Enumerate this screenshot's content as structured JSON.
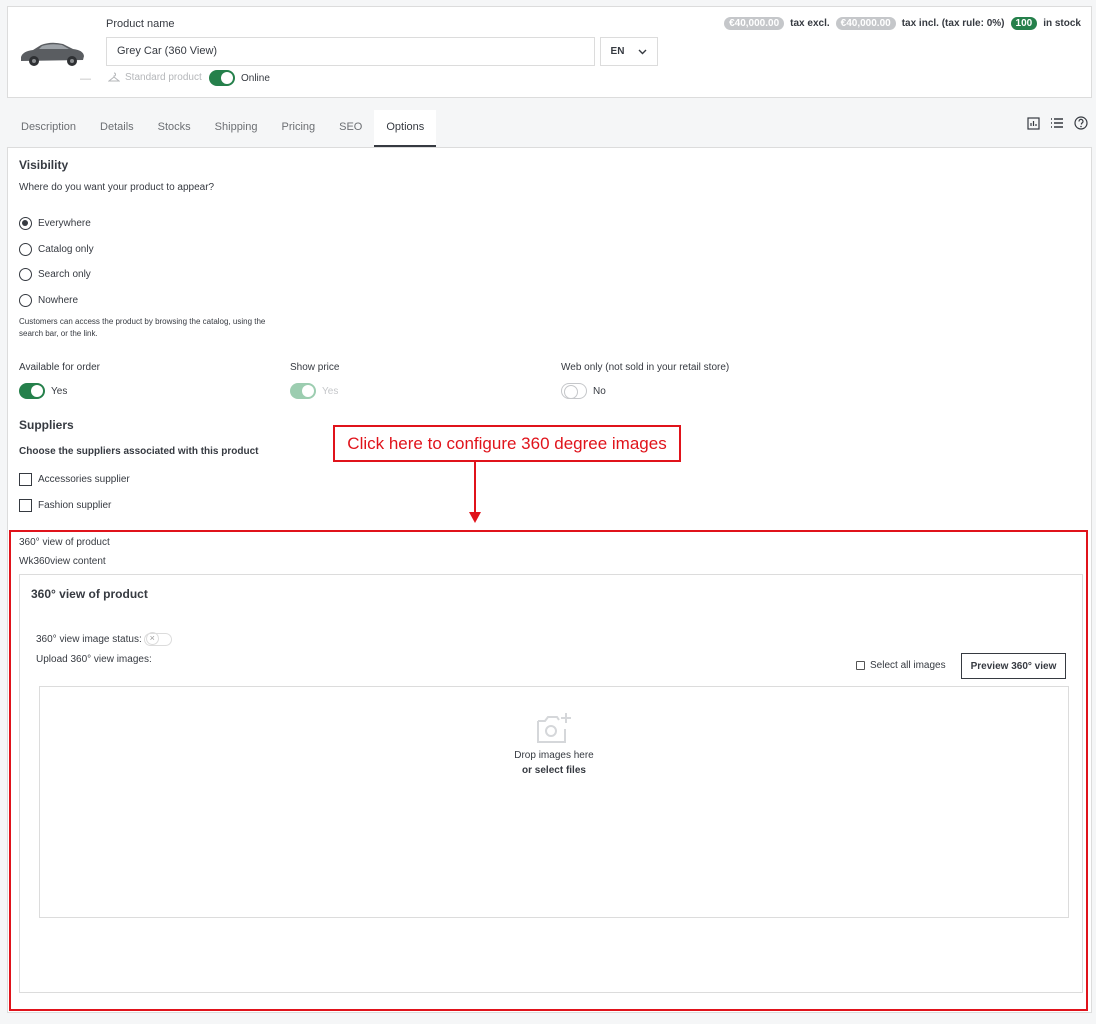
{
  "header": {
    "product_name_label": "Product name",
    "product_name_value": "Grey Car (360 View)",
    "language": "EN",
    "thumb_dash": "—",
    "product_type": "Standard product",
    "status_label": "Online",
    "price_excl": "€40,000.00",
    "tax_excl_label": "tax excl.",
    "price_incl": "€40,000.00",
    "tax_incl_label": "tax incl. (tax rule: 0%)",
    "stock_qty": "100",
    "stock_label": "in stock"
  },
  "tabs": [
    {
      "label": "Description"
    },
    {
      "label": "Details"
    },
    {
      "label": "Stocks"
    },
    {
      "label": "Shipping"
    },
    {
      "label": "Pricing"
    },
    {
      "label": "SEO"
    },
    {
      "label": "Options"
    }
  ],
  "active_tab": "Options",
  "visibility": {
    "title": "Visibility",
    "question": "Where do you want your product to appear?",
    "options": [
      {
        "label": "Everywhere",
        "checked": true
      },
      {
        "label": "Catalog only",
        "checked": false
      },
      {
        "label": "Search only",
        "checked": false
      },
      {
        "label": "Nowhere",
        "checked": false
      }
    ],
    "help_text": "Customers can access the product by browsing the catalog, using the search bar, or the link."
  },
  "order_options": {
    "available_label": "Available for order",
    "available_value": "Yes",
    "show_price_label": "Show price",
    "show_price_value": "Yes",
    "web_only_label": "Web only (not sold in your retail store)",
    "web_only_value": "No"
  },
  "suppliers": {
    "title": "Suppliers",
    "subtitle": "Choose the suppliers associated with this product",
    "items": [
      {
        "label": "Accessories supplier"
      },
      {
        "label": "Fashion supplier"
      }
    ]
  },
  "view360": {
    "section_label": "360° view of product",
    "content_label": "Wk360view content",
    "card_title": "360° view of product",
    "status_label": "360° view image status:",
    "upload_label": "Upload 360° view images:",
    "select_all_label": "Select all images",
    "preview_button": "Preview 360° view",
    "drop_text": "Drop images here",
    "select_files_text": "or select files"
  },
  "annotation": {
    "callout_text": "Click here to configure 360 degree images",
    "color": "#e0131b"
  },
  "colors": {
    "accent_green": "#25804b",
    "text": "#363a41",
    "border": "#dcdcdc"
  },
  "icons": [
    "car-thumbnail",
    "hanger-icon",
    "chevron-down-icon",
    "stats-icon",
    "list-icon",
    "help-icon",
    "add-photo-icon",
    "arrow-down-icon"
  ]
}
